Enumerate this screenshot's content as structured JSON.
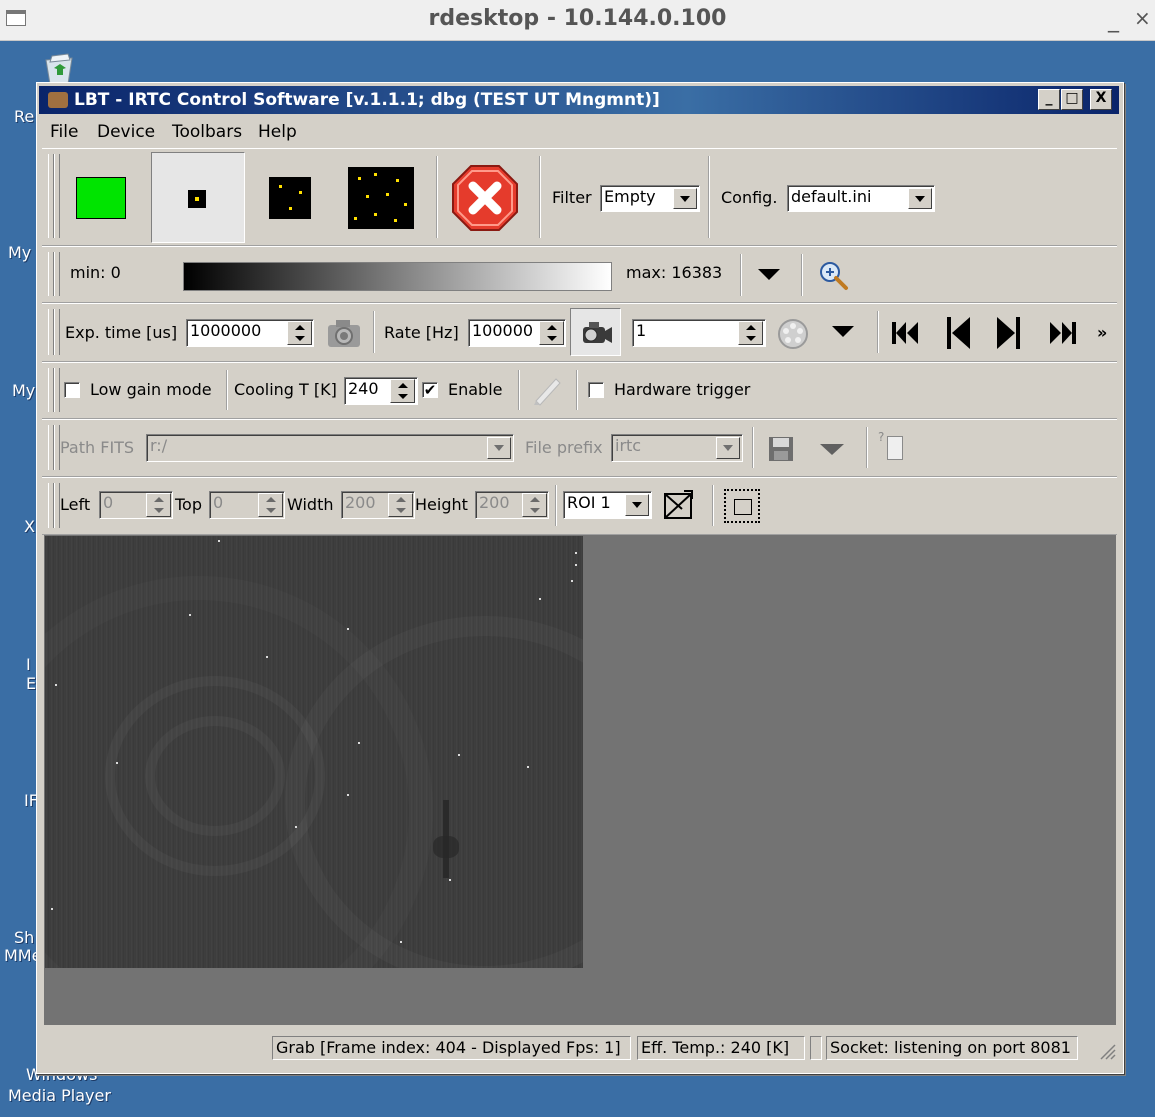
{
  "rdesktop": {
    "title": "rdesktop - 10.144.0.100",
    "minimize": "_",
    "close": "×"
  },
  "desktop": {
    "icons": [
      {
        "label": "Re"
      },
      {
        "label": "My"
      },
      {
        "label": "My"
      },
      {
        "label": "X"
      },
      {
        "label": "I"
      },
      {
        "label": "E"
      },
      {
        "label": "IF"
      },
      {
        "label": "Sh"
      },
      {
        "label": "MMe"
      },
      {
        "label": "Windows"
      },
      {
        "label": "Media Player"
      }
    ]
  },
  "window": {
    "title": "LBT - IRTC Control Software [v.1.1.1; dbg (TEST UT Mngmnt)]",
    "controls": {
      "min": "_",
      "max": "□",
      "close": "X"
    }
  },
  "menu": [
    "File",
    "Device",
    "Toolbars",
    "Help"
  ],
  "toolbar1": {
    "mode_buttons": [
      "green-frame-mode",
      "single-star-mode",
      "few-stars-mode",
      "many-stars-mode"
    ],
    "stop_icon": "stop-icon",
    "filter_label": "Filter",
    "filter_value": "Empty",
    "config_label": "Config.",
    "config_value": "default.ini"
  },
  "toolbar2": {
    "min_label": "min: 0",
    "max_label": "max: 16383",
    "zoom_icon": "zoom-in-icon"
  },
  "toolbar3": {
    "exp_label": "Exp. time [us]",
    "exp_value": "1000000",
    "rate_label": "Rate [Hz]",
    "rate_value": "100000",
    "frame_value": "1",
    "more": "»"
  },
  "toolbar4": {
    "low_gain_label": "Low gain mode",
    "low_gain_checked": false,
    "cooling_label": "Cooling T [K]",
    "cooling_value": "240",
    "enable_label": "Enable",
    "enable_checked": true,
    "enable_mark": "✔",
    "hw_trigger_label": "Hardware trigger",
    "hw_trigger_checked": false
  },
  "toolbar5": {
    "path_label": "Path FITS",
    "path_value": "r:/",
    "prefix_label": "File prefix",
    "prefix_value": "irtc",
    "help_glyph": "?"
  },
  "toolbar6": {
    "left_label": "Left",
    "left_value": "0",
    "top_label": "Top",
    "top_value": "0",
    "width_label": "Width",
    "width_value": "200",
    "height_label": "Height",
    "height_value": "200",
    "roi_value": "ROI 1"
  },
  "status": {
    "grab": "Grab [Frame index: 404 - Displayed Fps: 1]",
    "temp": "Eff. Temp.: 240 [K]",
    "socket": "Socket: listening on port 8081"
  }
}
